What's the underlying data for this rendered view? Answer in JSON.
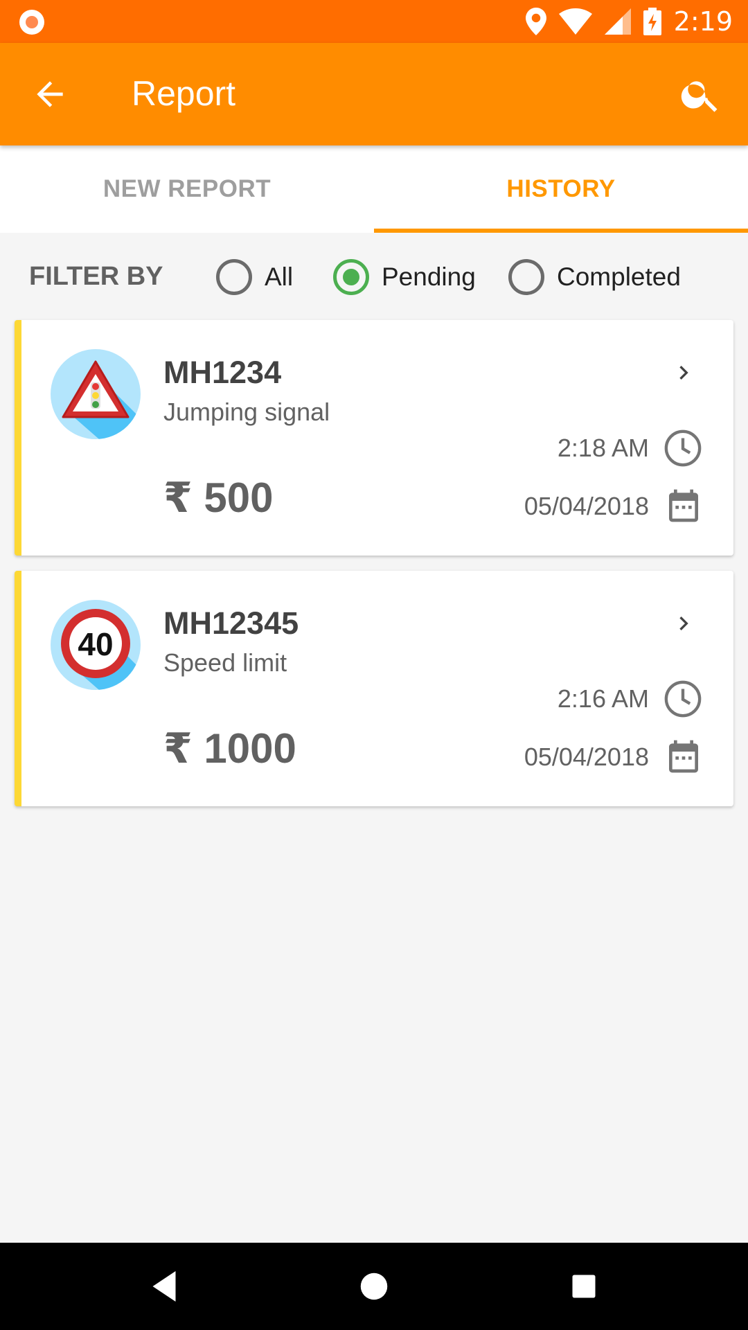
{
  "status_bar": {
    "time": "2:19",
    "icons": [
      "notification-icon",
      "location-icon",
      "wifi-icon",
      "signal-icon",
      "battery-charging-icon"
    ]
  },
  "app_bar": {
    "title": "Report",
    "back_icon": "arrow-back-icon",
    "search_icon": "search-icon"
  },
  "tabs": [
    {
      "label": "NEW REPORT",
      "selected": false
    },
    {
      "label": "HISTORY",
      "selected": true
    }
  ],
  "filter": {
    "label": "FILTER BY",
    "options": [
      {
        "label": "All",
        "selected": false
      },
      {
        "label": "Pending",
        "selected": true
      },
      {
        "label": "Completed",
        "selected": false
      }
    ]
  },
  "reports": [
    {
      "vehicle": "MH1234",
      "violation": "Jumping signal",
      "amount": "₹ 500",
      "time": "2:18 AM",
      "date": "05/04/2018",
      "icon": "traffic-signal-warning-icon"
    },
    {
      "vehicle": "MH12345",
      "violation": "Speed limit",
      "amount": "₹ 1000",
      "time": "2:16 AM",
      "date": "05/04/2018",
      "icon": "speed-limit-40-icon",
      "icon_text": "40"
    }
  ],
  "colors": {
    "status_bar": "#ff6d00",
    "app_bar": "#ff8c00",
    "tab_active": "#ff9800",
    "radio_checked": "#4caf50",
    "card_accent": "#fdd835"
  },
  "nav_bar": {
    "icons": [
      "nav-back-icon",
      "nav-home-icon",
      "nav-recents-icon"
    ]
  }
}
